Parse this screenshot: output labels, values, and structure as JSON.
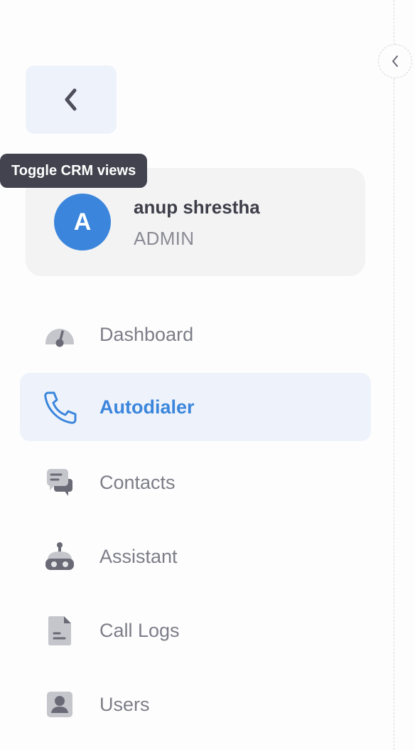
{
  "tooltip": {
    "text": "Toggle CRM views"
  },
  "user": {
    "initial": "A",
    "name": "anup shrestha",
    "role": "ADMIN"
  },
  "icons": {
    "back": "chevron-left-icon",
    "collapse": "chevron-left-icon"
  },
  "colors": {
    "accent": "#3b86dc",
    "active_bg": "#eef3fb",
    "icon_gray": "#9a9aa3",
    "tooltip_bg": "#43434f"
  },
  "nav": {
    "items": [
      {
        "label": "Dashboard",
        "icon": "gauge-icon",
        "active": false
      },
      {
        "label": "Autodialer",
        "icon": "phone-icon",
        "active": true
      },
      {
        "label": "Contacts",
        "icon": "chat-icon",
        "active": false
      },
      {
        "label": "Assistant",
        "icon": "robot-icon",
        "active": false
      },
      {
        "label": "Call Logs",
        "icon": "document-icon",
        "active": false
      },
      {
        "label": "Users",
        "icon": "user-icon",
        "active": false
      }
    ]
  }
}
